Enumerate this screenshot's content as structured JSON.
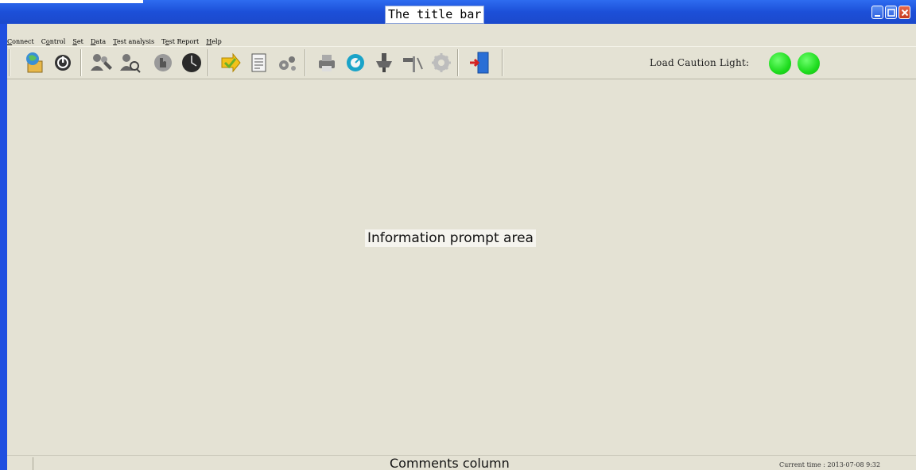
{
  "title_bar": {
    "title": "The title bar"
  },
  "window_controls": {
    "minimize": "minimize-icon",
    "maximize": "maximize-icon",
    "close": "close-icon"
  },
  "menu": {
    "items": [
      {
        "first": "C",
        "rest": "onnect"
      },
      {
        "pre": "C",
        "ul": "o",
        "post": "ntrol"
      },
      {
        "first": "S",
        "rest": "et"
      },
      {
        "first": "D",
        "rest": "ata"
      },
      {
        "first": "T",
        "rest": "est analysis"
      },
      {
        "pre": "T",
        "ul": "e",
        "post": "st Report"
      },
      {
        "first": "H",
        "rest": "elp"
      }
    ]
  },
  "toolbar": {
    "icons": [
      "connect-icon",
      "power-icon",
      "users-edit-icon",
      "user-search-icon",
      "touch-icon",
      "clock-icon",
      "arrow-icon",
      "document-icon",
      "gears-icon",
      "printer-icon",
      "chart-icon",
      "tool-icon",
      "hammer-icon",
      "settings-icon",
      "exit-door-icon"
    ],
    "caution_label": "Load Caution Light:",
    "lights": [
      {
        "color": "#1edc1e"
      },
      {
        "color": "#1edc1e"
      }
    ]
  },
  "main": {
    "prompt": "Information prompt area"
  },
  "status": {
    "comments": "Comments column",
    "time": "Current time : 2013-07-08 9:32"
  },
  "colors": {
    "title_blue": "#1c4fd8",
    "window_bg": "#e4e2d4",
    "light_green": "#1edc1e"
  }
}
